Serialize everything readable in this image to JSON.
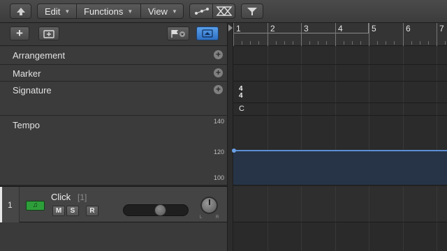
{
  "menubar": {
    "edit_label": "Edit",
    "functions_label": "Functions",
    "view_label": "View"
  },
  "global_tracks": {
    "arrangement_label": "Arrangement",
    "marker_label": "Marker",
    "signature_label": "Signature",
    "tempo_label": "Tempo"
  },
  "ruler": {
    "bars": [
      "1",
      "2",
      "3",
      "4",
      "5",
      "6",
      "7"
    ]
  },
  "signature": {
    "numerator": "4",
    "denominator": "4",
    "key": "C"
  },
  "tempo": {
    "scale_top": "140",
    "scale_mid": "120",
    "scale_bottom": "100",
    "bpm": 120
  },
  "track": {
    "number": "1",
    "name": "Click",
    "channel": "[1]",
    "mute": "M",
    "solo": "S",
    "record": "R",
    "pan_left": "L",
    "pan_right": "R",
    "volume_level": 0.5
  },
  "colors": {
    "accent": "#4a90d9",
    "tempo_line": "#5b8fd6",
    "instrument_icon": "#2e9e3a"
  }
}
